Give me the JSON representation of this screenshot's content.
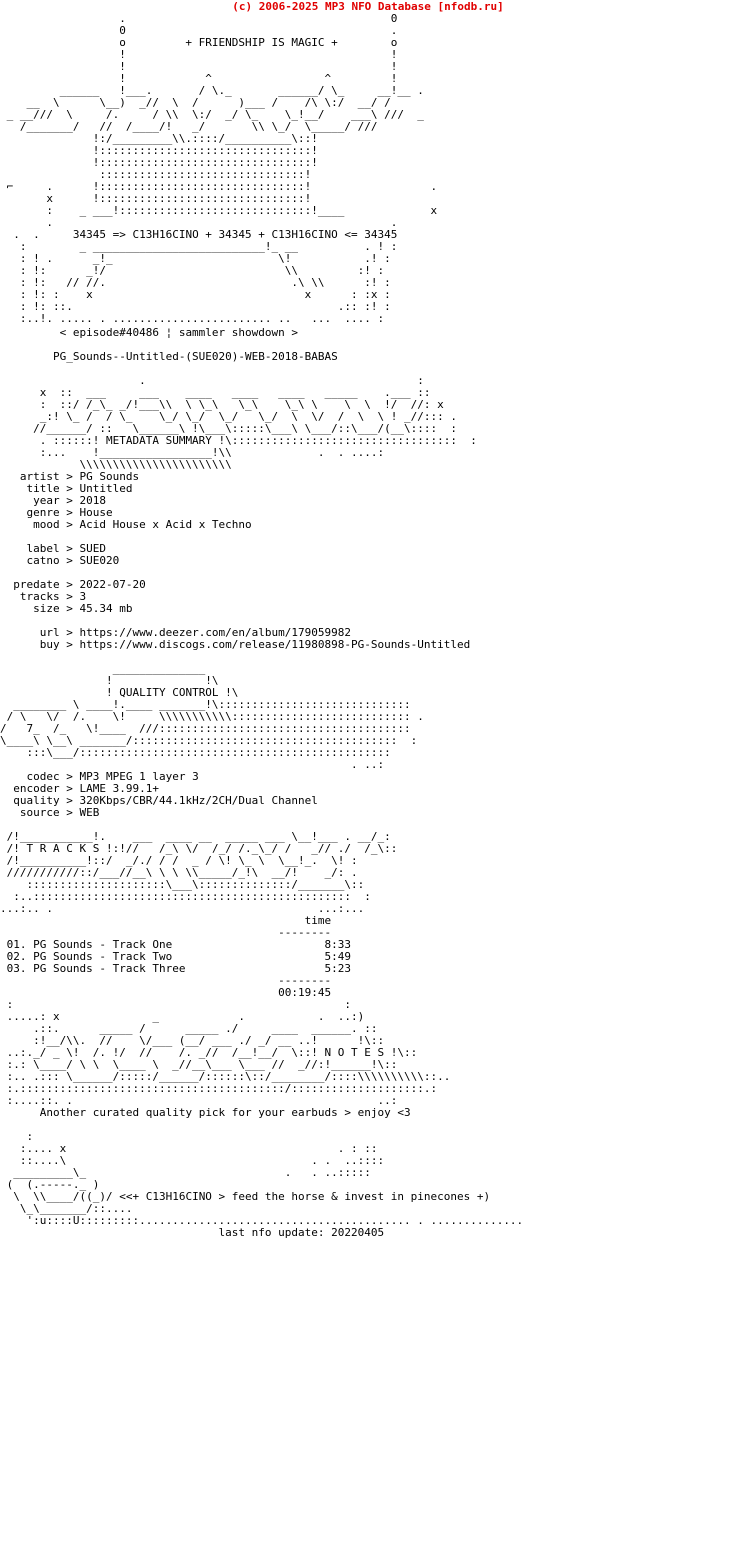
{
  "site_header": "(c) 2006-2025 MP3 NFO Database [nfodb.ru]",
  "tagline": "+ FRIENDSHIP IS MAGIC +",
  "equation_line": "34345 => C13H16CINO + 34345 + C13H16CINO <= 34345",
  "episode_line": "< episode#40486 ¦ sammler showdown >",
  "release_name": "PG_Sounds--Untitled-(SUE020)-WEB-2018-BABAS",
  "banners": {
    "metadata_summary": "METADATA SUMMARY",
    "quality_control": "QUALITY CONTROL",
    "tracks": "T R A C K S",
    "notes": "N O T E S"
  },
  "metadata": {
    "group_one": [
      {
        "key": "artist",
        "sep": ">",
        "value": "PG Sounds"
      },
      {
        "key": "title",
        "sep": ">",
        "value": "Untitled"
      },
      {
        "key": "year",
        "sep": ">",
        "value": "2018"
      },
      {
        "key": "genre",
        "sep": ">",
        "value": "House"
      },
      {
        "key": "mood",
        "sep": ">",
        "value": "Acid House x Acid x Techno"
      }
    ],
    "group_two": [
      {
        "key": "label",
        "sep": ">",
        "value": "SUED"
      },
      {
        "key": "catno",
        "sep": ">",
        "value": "SUE020"
      }
    ],
    "group_three": [
      {
        "key": "predate",
        "sep": ">",
        "value": "2022-07-20"
      },
      {
        "key": "tracks",
        "sep": ">",
        "value": "3"
      },
      {
        "key": "size",
        "sep": ">",
        "value": "45.34 mb"
      }
    ],
    "group_four": [
      {
        "key": "url",
        "sep": ">",
        "value": "https://www.deezer.com/en/album/179059982"
      },
      {
        "key": "buy",
        "sep": ">",
        "value": "https://www.discogs.com/release/11980898-PG-Sounds-Untitled"
      }
    ]
  },
  "quality": [
    {
      "key": "codec",
      "sep": ">",
      "value": "MP3 MPEG 1 layer 3"
    },
    {
      "key": "encoder",
      "sep": ">",
      "value": "LAME 3.99.1+"
    },
    {
      "key": "quality",
      "sep": ">",
      "value": "320Kbps/CBR/44.1kHz/2CH/Dual Channel"
    },
    {
      "key": "source",
      "sep": ">",
      "value": "WEB"
    }
  ],
  "tracklist": {
    "time_header": "time",
    "rule": "--------",
    "rows": [
      {
        "num": "01.",
        "title": "PG Sounds - Track One",
        "time": "8:33"
      },
      {
        "num": "02.",
        "title": "PG Sounds - Track Two",
        "time": "5:49"
      },
      {
        "num": "03.",
        "title": "PG Sounds - Track Three",
        "time": "5:23"
      }
    ],
    "total": "00:19:45"
  },
  "notes_text": "Another curated quality pick for your earbuds > enjoy <3",
  "footer_slogan": "<<+ C13H16CINO > feed the horse & invest in pinecones +)",
  "last_update": "last nfo update: 20220405",
  "colors": {
    "header_red": "#e00000",
    "text_black": "#000000",
    "background": "#ffffff"
  },
  "ascii_art": {
    "header_logo": [
      "                  .                                         0        ",
      "                  0                                         .        ",
      "                  o              + FRIENDSHIP IS MAGIC +    o        ",
      "                  !                                         !        ",
      "                  !                                         !        ",
      "                  !              ^                ^         !        ",
      "        ______    !___.         / \\._      ______/ \\_     __!__ .    ",
      "   __  \\      \\___)  _//  \\    /      )___/     /\\ \\:/  __/ /        ",
      " _  __///  \\    /.      / \\\\  \\:/   _/ \\_     \\_!__/    ___\\ ///  _  ",
      "    /________/  //   /____/!   _/        \\\\ \\_/   \\_____/ ///        ",
      "               !:/_________\\\\.::::/__________\\::!                    ",
      "               !::::::::::::::::::::::::::::::::!                    ",
      "               !::::::::::::::::::::::::::::::::!                    ",
      "                :::::::::::::::::::::::::::::::!                     ",
      " ⌐      .      !:::::::::::::::::::::::::::::::!                   . ",
      "        x      !:::::::::::::::::::::::::::::::!                     ",
      "        :    _ ___!:::::::::::::::::::::::::::::!____              x ",
      "                                                                     ",
      "        .                                                    .       ",
      "   .  .      34345 => C13H16CINO + 34345 + C13H16CINO <= 34345       "
    ],
    "header_lower": [
      "   :        _ ___________________________!_ __          . ! :        ",
      "   : ! .       _!_                          \\!           .! :        ",
      "   : !:       _!/                            \\\\         :! :        ",
      "   : !:    // //.                             .\\ \\\\      :! :        ",
      "   : !: :     x                                 x      : :x :        ",
      "   : !: ::.                                          .:: :! :        ",
      "   :..!. ..... . .......................... ..   ...  .... :        "
    ]
  }
}
